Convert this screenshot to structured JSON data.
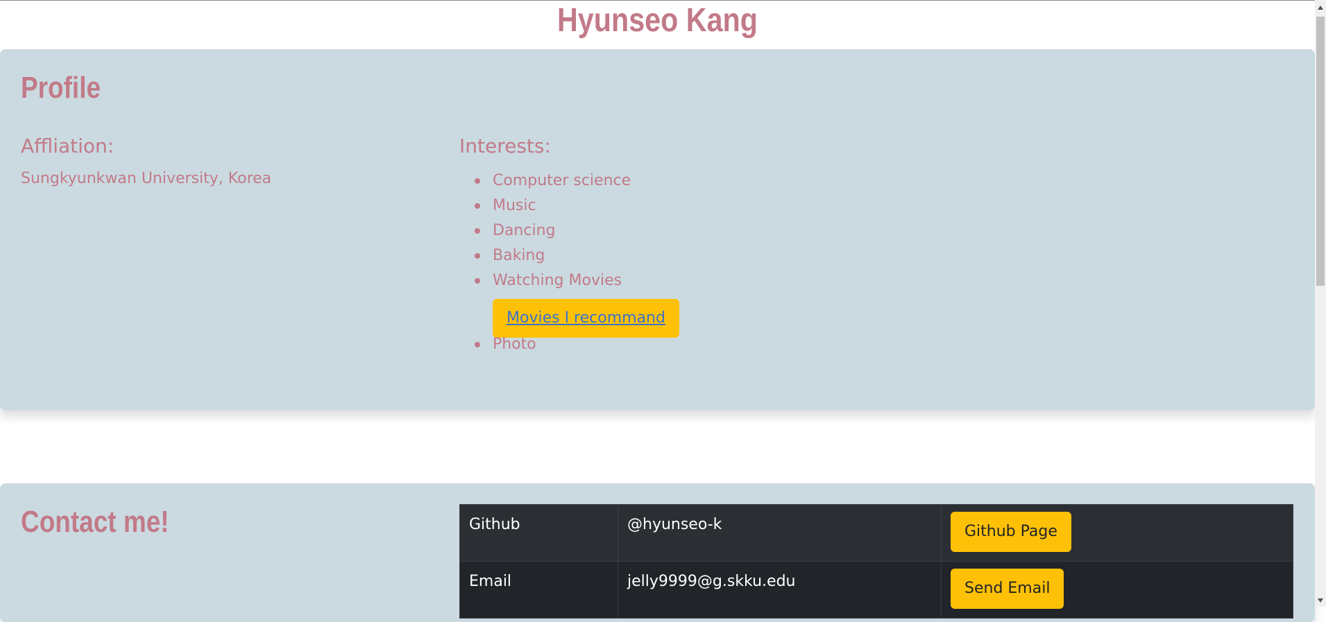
{
  "header": {
    "name": "Hyunseo Kang"
  },
  "profile": {
    "title": "Profile",
    "affiliation_label": "Affliation:",
    "affiliation_value": "Sungkyunkwan University, Korea",
    "interests_label": "Interests:",
    "interests": [
      "Computer science",
      "Music",
      "Dancing",
      "Baking",
      "Watching Movies",
      "Photo"
    ],
    "movies_button": "Movies I recommand"
  },
  "contact": {
    "title": "Contact me!",
    "rows": [
      {
        "label": "Github",
        "value": "@hyunseo-k",
        "button": "Github Page"
      },
      {
        "label": "Email",
        "value": "jelly9999@g.skku.edu",
        "button": "Send Email"
      }
    ]
  },
  "colors": {
    "accent": "#c27a88",
    "card": "#cbdae1",
    "button": "#ffc107",
    "link": "#3a73c8",
    "table_dark": "#212428"
  }
}
